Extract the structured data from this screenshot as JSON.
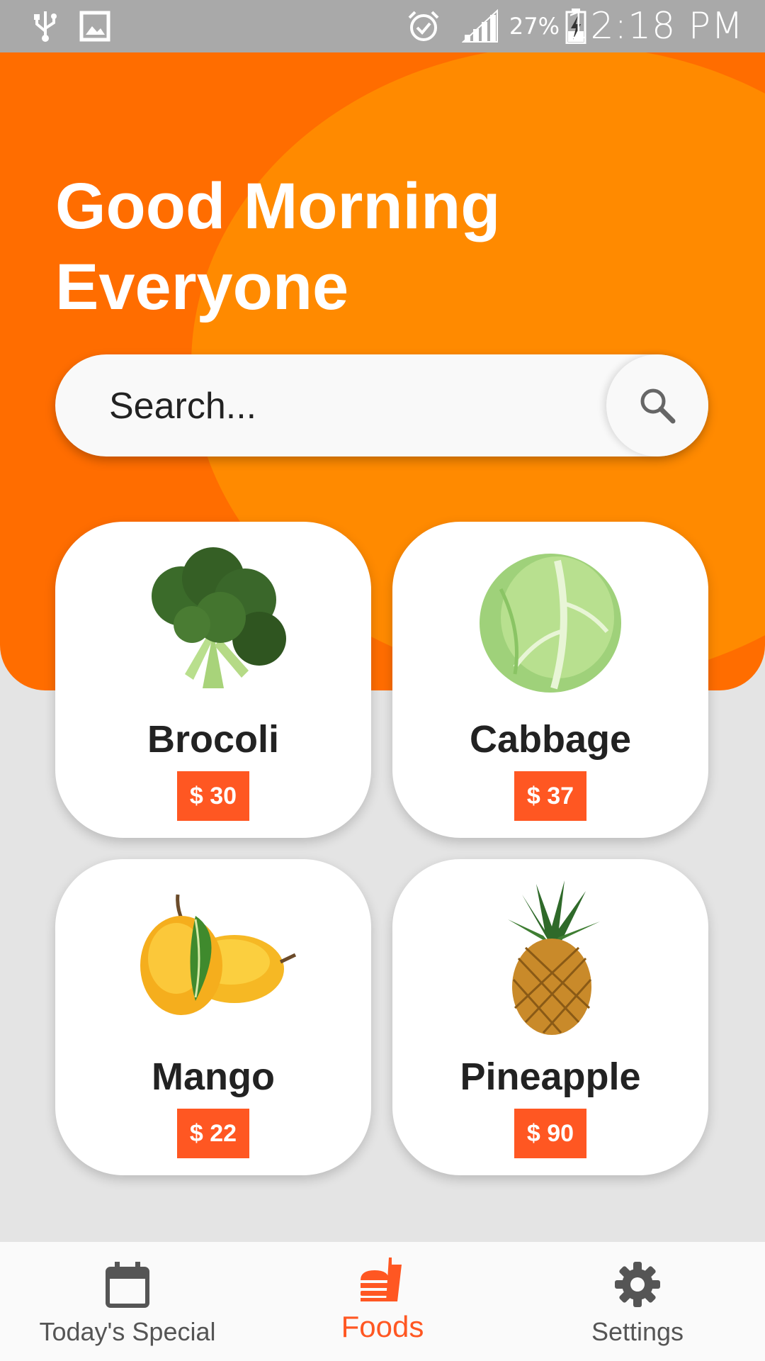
{
  "status_bar": {
    "time": "12:18 PM",
    "battery_percent": "27%",
    "icons": [
      "usb-icon",
      "image-icon",
      "alarm-icon",
      "signal-icon",
      "battery-charging-icon"
    ]
  },
  "header": {
    "greeting_line1": "Good Morning",
    "greeting_line2": "Everyone"
  },
  "search": {
    "placeholder": "Search...",
    "icon": "search-icon"
  },
  "products": [
    {
      "name": "Brocoli",
      "price": "$ 30",
      "image": "broccoli"
    },
    {
      "name": "Cabbage",
      "price": "$ 37",
      "image": "cabbage"
    },
    {
      "name": "Mango",
      "price": "$ 22",
      "image": "mango"
    },
    {
      "name": "Pineapple",
      "price": "$ 90",
      "image": "pineapple"
    }
  ],
  "bottom_nav": {
    "items": [
      {
        "label": "Today's Special",
        "icon": "calendar-icon",
        "active": false
      },
      {
        "label": "Foods",
        "icon": "fastfood-icon",
        "active": true
      },
      {
        "label": "Settings",
        "icon": "gear-icon",
        "active": false
      }
    ]
  },
  "colors": {
    "header_primary": "#ff6d00",
    "header_secondary": "#ff8a00",
    "price_badge": "#ff5722",
    "active_nav": "#ff5722"
  }
}
